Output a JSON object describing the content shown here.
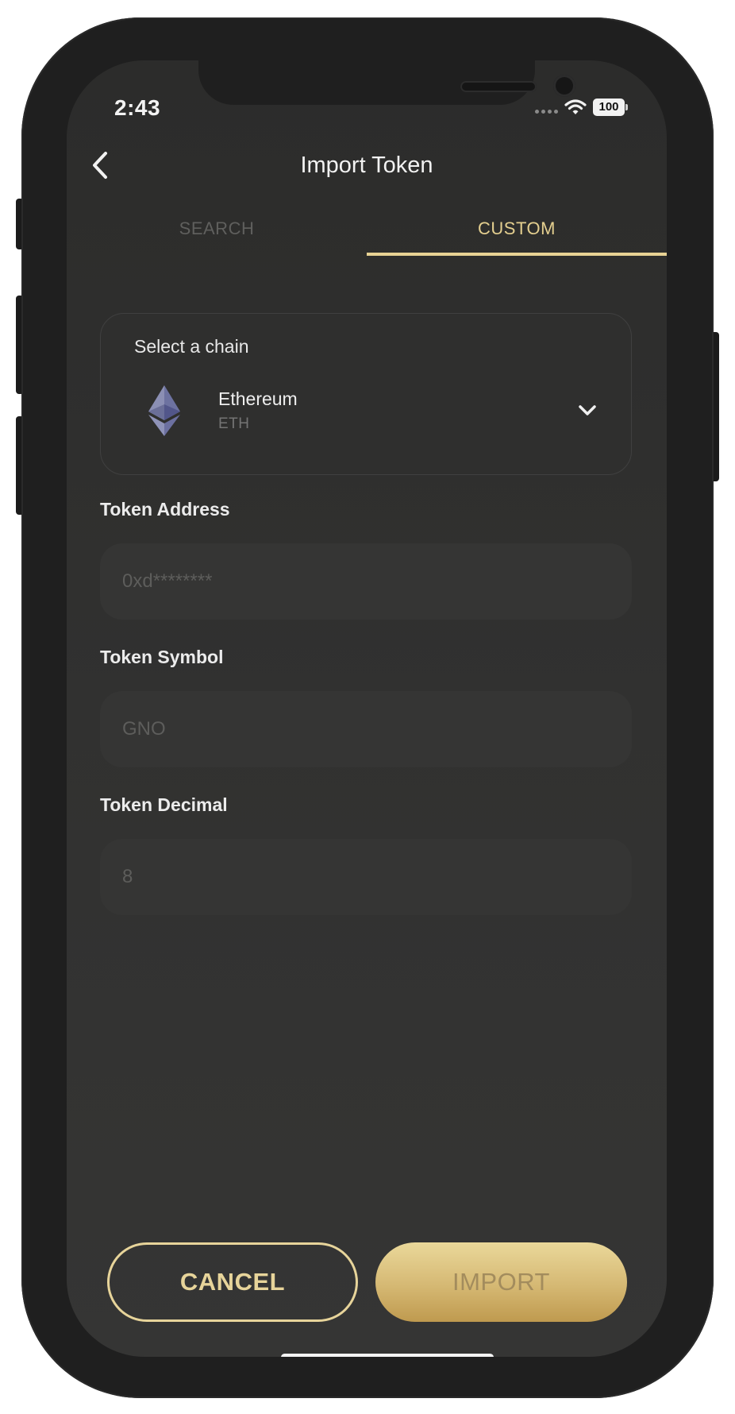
{
  "status_bar": {
    "time": "2:43",
    "battery": "100",
    "icons": [
      "cellular-signal-icon",
      "wifi-icon",
      "battery-icon"
    ]
  },
  "nav": {
    "title": "Import Token",
    "back_icon": "chevron-left-icon"
  },
  "tabs": [
    {
      "label": "SEARCH",
      "active": false
    },
    {
      "label": "CUSTOM",
      "active": true
    }
  ],
  "chain_selector": {
    "label": "Select a chain",
    "selected": {
      "name": "Ethereum",
      "symbol": "ETH",
      "icon": "ethereum-logo"
    },
    "dropdown_icon": "chevron-down-icon"
  },
  "form": {
    "token_address": {
      "label": "Token Address",
      "placeholder": "0xd********",
      "value": ""
    },
    "token_symbol": {
      "label": "Token Symbol",
      "placeholder": "GNO",
      "value": ""
    },
    "token_decimal": {
      "label": "Token Decimal",
      "placeholder": "8",
      "value": ""
    }
  },
  "actions": {
    "cancel_label": "CANCEL",
    "import_label": "IMPORT"
  },
  "colors": {
    "accent_gold": "#e7d49a",
    "background": "#2f2f2e",
    "device_frame": "#1f1f1f"
  }
}
